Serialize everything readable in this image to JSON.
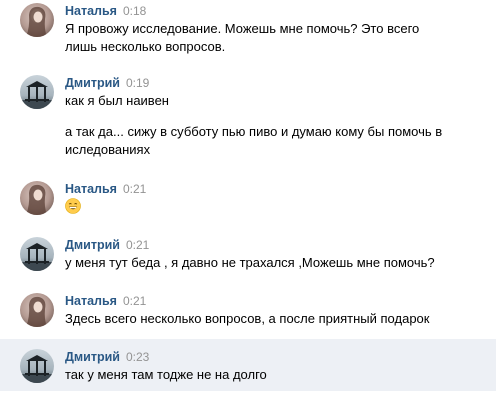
{
  "messages": [
    {
      "author": "Наталья",
      "time": "0:18",
      "avatar": "natalya-avatar",
      "lines": [
        "Я провожу исследование. Можешь мне помочь? Это всего",
        "лишь несколько вопросов."
      ]
    },
    {
      "author": "Дмитрий",
      "time": "0:19",
      "avatar": "dmitry-avatar",
      "lines": [
        "как я был наивен"
      ]
    },
    {
      "author": "",
      "time": "",
      "lines": [
        "а так да... сижу в субботу пью пиво и думаю кому бы помочь в",
        "иследованиях"
      ]
    },
    {
      "author": "Наталья",
      "time": "0:21",
      "avatar": "natalya-avatar",
      "emoji": "grinning-face-emoji"
    },
    {
      "author": "Дмитрий",
      "time": "0:21",
      "avatar": "dmitry-avatar",
      "lines": [
        "у меня тут беда , я давно не трахался ,Можешь мне помочь?"
      ]
    },
    {
      "author": "Наталья",
      "time": "0:21",
      "avatar": "natalya-avatar",
      "lines": [
        "Здесь всего несколько вопросов, а после приятный подарок"
      ]
    },
    {
      "author": "Дмитрий",
      "time": "0:23",
      "avatar": "dmitry-avatar",
      "lines": [
        "так у меня там тодже не на долго"
      ]
    }
  ],
  "colors": {
    "author_name": "#2a5885",
    "timestamp": "#939393",
    "highlight_background": "#edf0f5"
  }
}
